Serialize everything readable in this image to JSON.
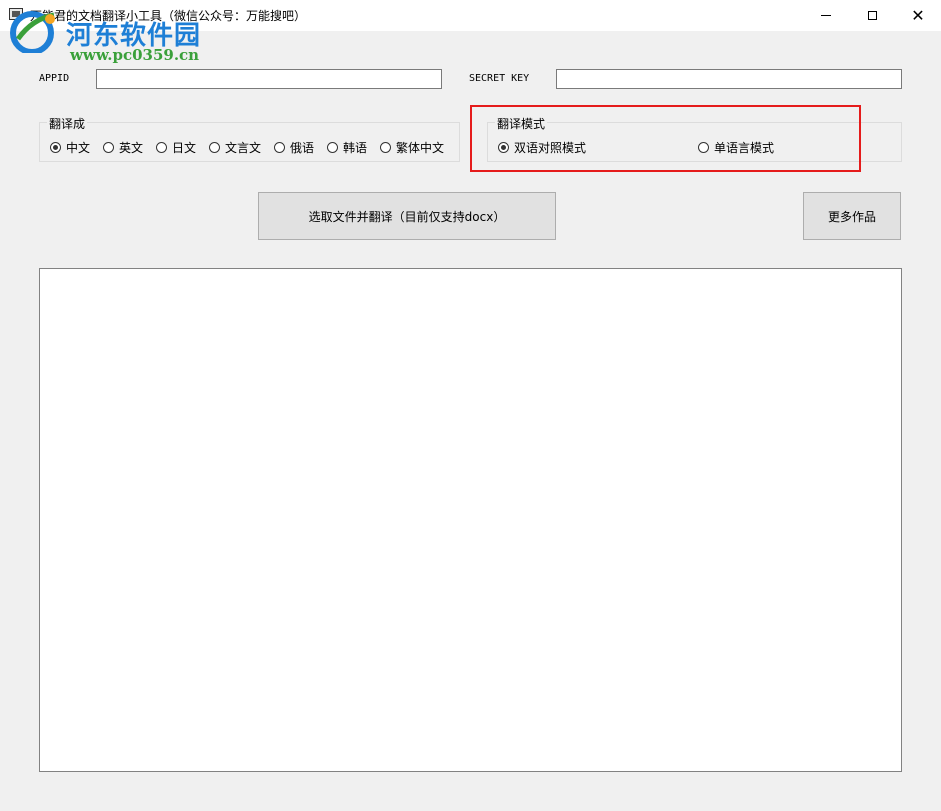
{
  "window": {
    "title": "万能君的文档翻译小工具（微信公众号：万能搜吧）",
    "minimize_glyph": "",
    "close_glyph": "✕"
  },
  "watermark": {
    "title": "河东软件园",
    "url": "www.pc0359.cn"
  },
  "fields": {
    "appid_label": "APPID",
    "appid_value": "",
    "secret_label": "SECRET KEY",
    "secret_value": ""
  },
  "translate_to": {
    "legend": "翻译成",
    "options": [
      {
        "label": "中文",
        "checked": true
      },
      {
        "label": "英文",
        "checked": false
      },
      {
        "label": "日文",
        "checked": false
      },
      {
        "label": "文言文",
        "checked": false
      },
      {
        "label": "俄语",
        "checked": false
      },
      {
        "label": "韩语",
        "checked": false
      },
      {
        "label": "繁体中文",
        "checked": false
      }
    ]
  },
  "translate_mode": {
    "legend": "翻译模式",
    "options": [
      {
        "label": "双语对照模式",
        "checked": true
      },
      {
        "label": "单语言模式",
        "checked": false
      }
    ]
  },
  "buttons": {
    "select_translate": "选取文件并翻译（目前仅支持docx）",
    "more_works": "更多作品"
  },
  "colors": {
    "highlight": "#e51b1b",
    "watermark_title": "#1e7fd6",
    "watermark_url": "#3aa03a"
  }
}
